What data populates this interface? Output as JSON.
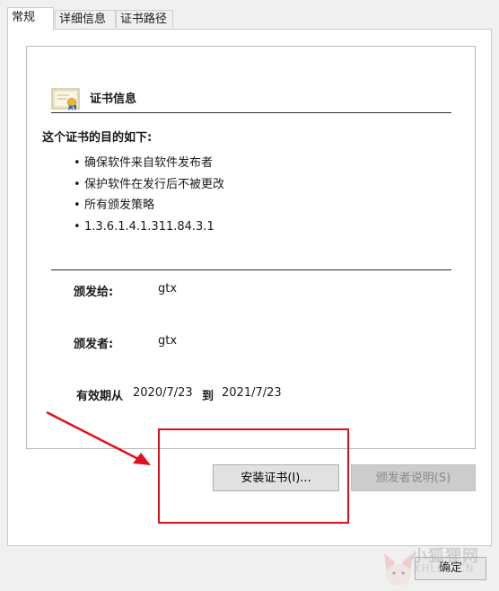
{
  "tabs": [
    {
      "label": "常规",
      "active": true
    },
    {
      "label": "详细信息",
      "active": false
    },
    {
      "label": "证书路径",
      "active": false
    }
  ],
  "certificate": {
    "title": "证书信息",
    "purpose_heading": "这个证书的目的如下:",
    "purposes": [
      "确保软件来自软件发布者",
      "保护软件在发行后不被更改",
      "所有颁发策略",
      "1.3.6.1.4.1.311.84.3.1"
    ],
    "issued_to_label": "颁发给:",
    "issued_to_value": "gtx",
    "issued_by_label": "颁发者:",
    "issued_by_value": "gtx",
    "validity_label": "有效期从",
    "valid_from": "2020/7/23",
    "to_label": "到",
    "valid_to": "2021/7/23"
  },
  "buttons": {
    "install_label": "安装证书(I)...",
    "issuer_statement_label": "颁发者说明(S)",
    "ok_label": "确定"
  },
  "watermark": {
    "text": "小狐狸网",
    "sub": "XHLKS.CN"
  },
  "colors": {
    "annotation_red": "#e0101a",
    "window_bg": "#f0f0f0",
    "panel_bg": "#ffffff"
  }
}
